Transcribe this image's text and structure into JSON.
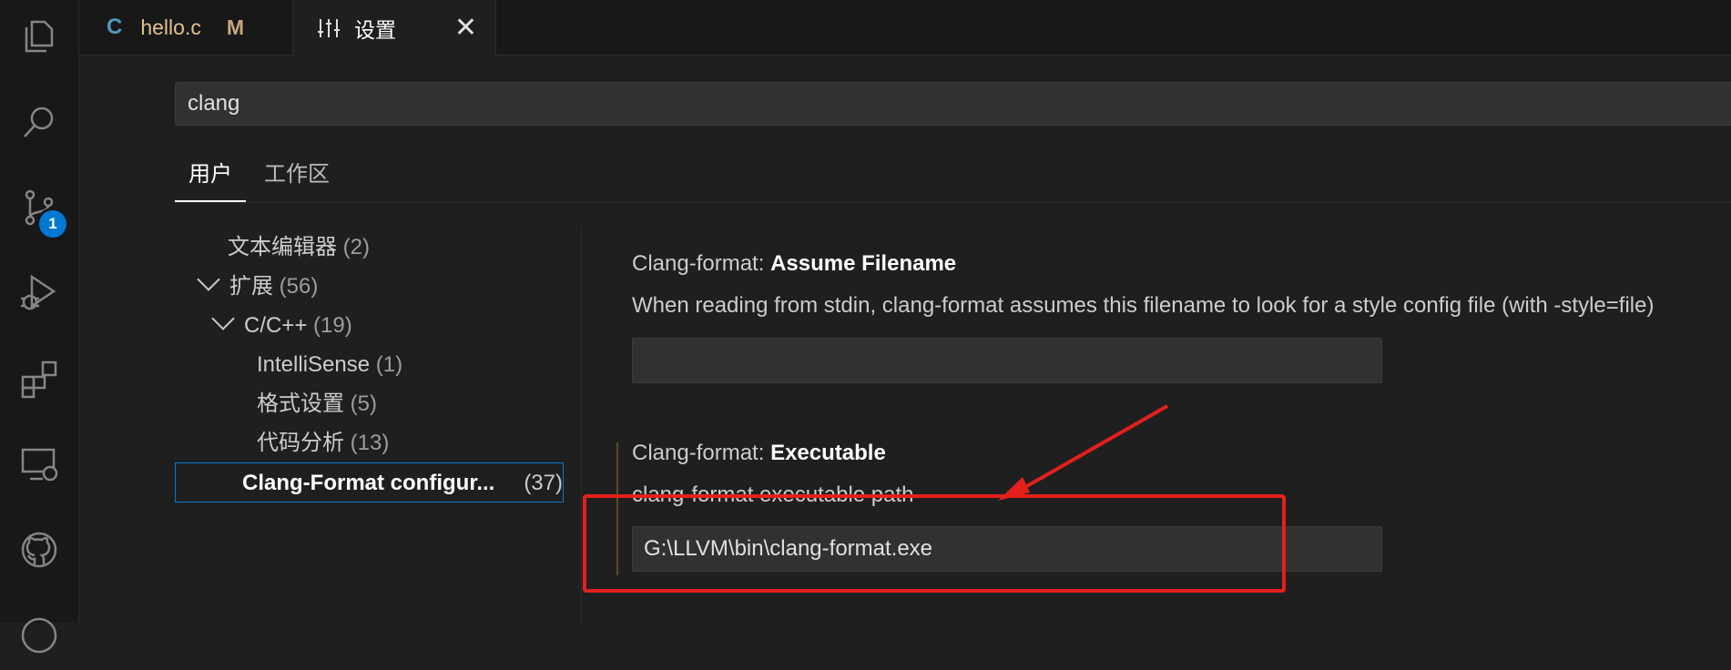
{
  "activity_bar": {
    "icons": [
      "explorer-icon",
      "search-icon",
      "source-control-icon",
      "run-debug-icon",
      "extensions-icon",
      "remote-explorer-icon",
      "github-icon",
      "account-icon"
    ],
    "source_control_badge": "1"
  },
  "tabs": [
    {
      "icon_text": "C",
      "label": "hello.c",
      "status": "M"
    },
    {
      "label": "设置",
      "close": "✕"
    }
  ],
  "search": {
    "value": "clang"
  },
  "scope_tabs": {
    "user": "用户",
    "workspace": "工作区"
  },
  "toc": [
    {
      "label": "文本编辑器",
      "count": "(2)"
    },
    {
      "label": "扩展",
      "count": "(56)"
    },
    {
      "label": "C/C++",
      "count": "(19)"
    },
    {
      "label": "IntelliSense",
      "count": "(1)"
    },
    {
      "label": "格式设置",
      "count": "(5)"
    },
    {
      "label": "代码分析",
      "count": "(13)"
    },
    {
      "label": "Clang-Format configur...",
      "count": "(37)"
    }
  ],
  "settings": [
    {
      "prefix": "Clang-format: ",
      "name": "Assume Filename",
      "description": "When reading from stdin, clang-format assumes this filename to look for a style config file (with -style=file)",
      "value": ""
    },
    {
      "prefix": "Clang-format: ",
      "name": "Executable",
      "description": "clang-format executable path",
      "value": "G:\\LLVM\\bin\\clang-format.exe"
    }
  ],
  "colors": {
    "accent": "#0078d4",
    "annotation": "#e3201d",
    "modified": "#e2c08d"
  }
}
